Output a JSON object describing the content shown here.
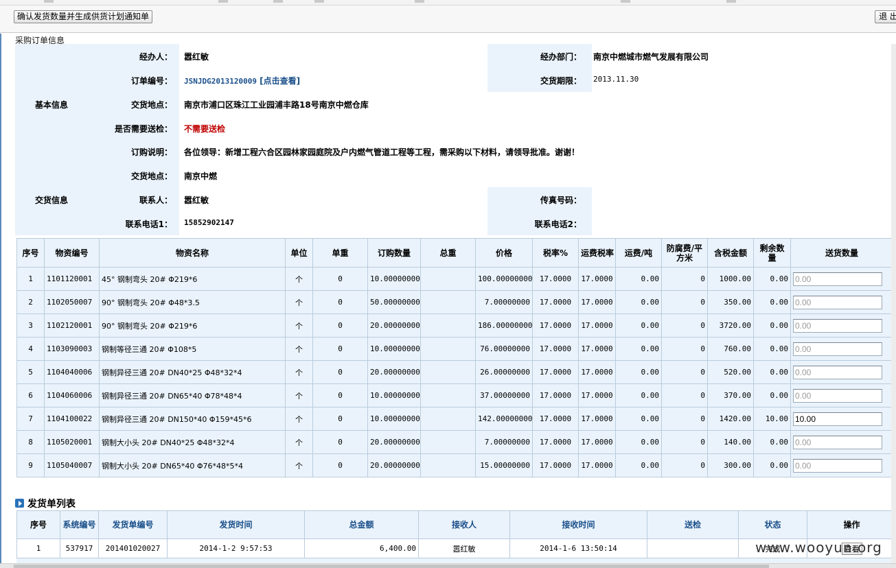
{
  "toolbar": {
    "confirm_button": "确认发货数量并生成供货计划通知单",
    "exit_button": "退 出"
  },
  "section_title": "采购订单信息",
  "basic_info": {
    "section_label": "基本信息",
    "handler_label": "经办人：",
    "handler_value": "嚣红敏",
    "dept_label": "经办部门：",
    "dept_value": "南京中燃城市燃气发展有限公司",
    "order_no_label": "订单编号：",
    "order_no_value": "JSNJDG2013120009",
    "order_view_link": "[点击查看]",
    "deadline_label": "交货期限：",
    "deadline_value": "2013.11.30",
    "location_label": "交货地点：",
    "location_value": "南京市浦口区珠江工业园浦丰路18号南京中燃仓库",
    "inspect_label": "是否需要送检：",
    "inspect_value": "不需要送检",
    "desc_label": "订购说明：",
    "desc_value": "各位领导：新增工程六合区园林家园庭院及户内燃气管道工程等工程，需采购以下材料，请领导批准。谢谢！"
  },
  "delivery_info": {
    "section_label": "交货信息",
    "location_label": "交货地点：",
    "location_value": "南京中燃",
    "contact_label": "联系人：",
    "contact_value": "嚣红敏",
    "fax_label": "传真号码：",
    "fax_value": "",
    "phone1_label": "联系电话1：",
    "phone1_value": "15852902147",
    "phone2_label": "联系电话2：",
    "phone2_value": ""
  },
  "items_table": {
    "headers": [
      "序号",
      "物资编号",
      "物资名称",
      "单位",
      "单重",
      "订购数量",
      "总重",
      "价格",
      "税率%",
      "运费税率",
      "运费/吨",
      "防腐费/平方米",
      "含税金额",
      "剩余数量",
      "送货数量"
    ],
    "rows": [
      {
        "no": "1",
        "code": "1101120001",
        "name": "45° 钢制弯头 20# Φ219*6",
        "unit": "个",
        "unit_weight": "0",
        "qty": "10.00000000",
        "total_weight": "",
        "price": "100.00000000",
        "tax": "17.0000",
        "freight_tax": "17.0000",
        "freight": "0.00",
        "anti": "0",
        "amount": "1000.00",
        "remain": "0.00",
        "ship_qty": "0.00"
      },
      {
        "no": "2",
        "code": "1102050007",
        "name": "90° 钢制弯头 20# Φ48*3.5",
        "unit": "个",
        "unit_weight": "0",
        "qty": "50.00000000",
        "total_weight": "",
        "price": "7.00000000",
        "tax": "17.0000",
        "freight_tax": "17.0000",
        "freight": "0.00",
        "anti": "0",
        "amount": "350.00",
        "remain": "0.00",
        "ship_qty": "0.00"
      },
      {
        "no": "3",
        "code": "1102120001",
        "name": "90° 钢制弯头 20# Φ219*6",
        "unit": "个",
        "unit_weight": "0",
        "qty": "20.00000000",
        "total_weight": "",
        "price": "186.00000000",
        "tax": "17.0000",
        "freight_tax": "17.0000",
        "freight": "0.00",
        "anti": "0",
        "amount": "3720.00",
        "remain": "0.00",
        "ship_qty": "0.00"
      },
      {
        "no": "4",
        "code": "1103090003",
        "name": "钢制等径三通 20# Φ108*5",
        "unit": "个",
        "unit_weight": "0",
        "qty": "10.00000000",
        "total_weight": "",
        "price": "76.00000000",
        "tax": "17.0000",
        "freight_tax": "17.0000",
        "freight": "0.00",
        "anti": "0",
        "amount": "760.00",
        "remain": "0.00",
        "ship_qty": "0.00"
      },
      {
        "no": "5",
        "code": "1104040006",
        "name": "钢制异径三通 20# DN40*25 Φ48*32*4",
        "unit": "个",
        "unit_weight": "0",
        "qty": "20.00000000",
        "total_weight": "",
        "price": "26.00000000",
        "tax": "17.0000",
        "freight_tax": "17.0000",
        "freight": "0.00",
        "anti": "0",
        "amount": "520.00",
        "remain": "0.00",
        "ship_qty": "0.00"
      },
      {
        "no": "6",
        "code": "1104060006",
        "name": "钢制异径三通 20# DN65*40 Φ78*48*4",
        "unit": "个",
        "unit_weight": "0",
        "qty": "10.00000000",
        "total_weight": "",
        "price": "37.00000000",
        "tax": "17.0000",
        "freight_tax": "17.0000",
        "freight": "0.00",
        "anti": "0",
        "amount": "370.00",
        "remain": "0.00",
        "ship_qty": "0.00"
      },
      {
        "no": "7",
        "code": "1104100022",
        "name": "钢制异径三通 20# DN150*40 Φ159*45*6",
        "unit": "个",
        "unit_weight": "0",
        "qty": "10.00000000",
        "total_weight": "",
        "price": "142.00000000",
        "tax": "17.0000",
        "freight_tax": "17.0000",
        "freight": "0.00",
        "anti": "0",
        "amount": "1420.00",
        "remain": "10.00",
        "ship_qty": "10.00"
      },
      {
        "no": "8",
        "code": "1105020001",
        "name": "钢制大小头 20# DN40*25 Φ48*32*4",
        "unit": "个",
        "unit_weight": "0",
        "qty": "20.00000000",
        "total_weight": "",
        "price": "7.00000000",
        "tax": "17.0000",
        "freight_tax": "17.0000",
        "freight": "0.00",
        "anti": "0",
        "amount": "140.00",
        "remain": "0.00",
        "ship_qty": "0.00"
      },
      {
        "no": "9",
        "code": "1105040007",
        "name": "钢制大小头 20# DN65*40 Φ76*48*5*4",
        "unit": "个",
        "unit_weight": "0",
        "qty": "20.00000000",
        "total_weight": "",
        "price": "15.00000000",
        "tax": "17.0000",
        "freight_tax": "17.0000",
        "freight": "0.00",
        "anti": "0",
        "amount": "300.00",
        "remain": "0.00",
        "ship_qty": "0.00"
      }
    ]
  },
  "shipments": {
    "title": "发货单列表",
    "headers": [
      "序号",
      "系统编号",
      "发货单编号",
      "发货时间",
      "总金额",
      "接收人",
      "接收时间",
      "送检",
      "状态",
      "操作"
    ],
    "rows": [
      {
        "no": "1",
        "sys_no": "537917",
        "ship_no": "201401020027",
        "ship_time": "2014-1-2 9:57:53",
        "total": "6,400.00",
        "receiver": "嚣红敏",
        "recv_time": "2014-1-6 13:50:14",
        "inspect": "",
        "status": "完成",
        "action": "查看"
      }
    ]
  },
  "watermark": "www.wooyun.org"
}
